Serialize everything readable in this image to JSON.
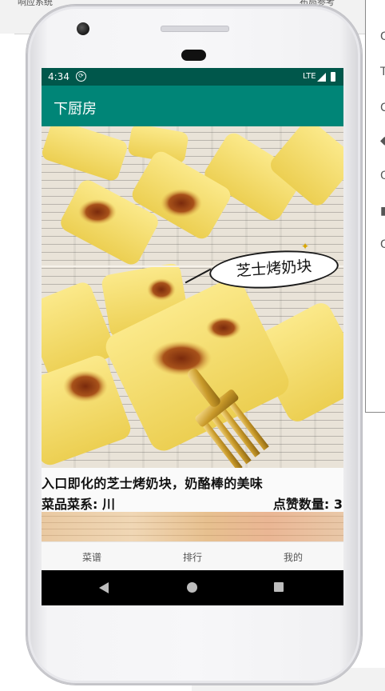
{
  "ide": {
    "top_left_fragment": "响应系统",
    "top_right_fragment": "布局参考",
    "right_panel_glyphs": [
      "G",
      "T",
      "C",
      "◆",
      "Q",
      "▮",
      "G"
    ]
  },
  "status_bar": {
    "time": "4:34",
    "network": "LTE"
  },
  "app_bar": {
    "title": "下厨房"
  },
  "recipe": {
    "image_label": "芝士烤奶块",
    "title": "入口即化的芝士烤奶块，奶酪棒的美味",
    "cuisine": "菜品菜系: 川",
    "likes": "点赞数量: 3"
  },
  "bottom_nav": {
    "items": [
      {
        "label": "菜谱"
      },
      {
        "label": "排行"
      },
      {
        "label": "我的"
      }
    ]
  },
  "colors": {
    "status_bar": "#00574b",
    "app_bar": "#008577",
    "system_nav": "#000000"
  },
  "icons": {
    "status_sync": "sync-circle-icon",
    "status_signal": "signal-icon",
    "status_battery": "battery-icon",
    "nav_back": "back-triangle-icon",
    "nav_home": "home-circle-icon",
    "nav_recents": "recents-square-icon"
  }
}
